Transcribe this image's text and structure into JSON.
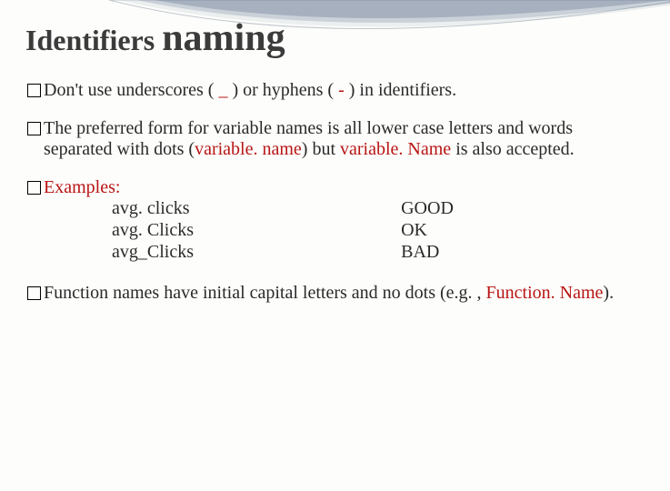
{
  "title": {
    "word1": "Identifiers",
    "word2": "naming"
  },
  "bullets": {
    "b1": {
      "pre": "Don't use underscores ( ",
      "us": "_",
      "mid": " ) or hyphens ( ",
      "hy": "-",
      "post": " ) in identifiers."
    },
    "b2": {
      "t1": "The preferred form for variable names is all lower case letters and words separated with dots (",
      "var1": "variable. name",
      "t2": ") but ",
      "var2": "variable. Name",
      "t3": " is also accepted."
    },
    "b3": {
      "label": "Examples:"
    },
    "b4": {
      "t1": "Function names have initial capital letters and no dots (e.g. , ",
      "fn": "Function. Name",
      "t2": ")."
    }
  },
  "examples": [
    {
      "name": "avg. clicks",
      "rating": "GOOD"
    },
    {
      "name": "avg. Clicks",
      "rating": "OK"
    },
    {
      "name": "avg_Clicks",
      "rating": "BAD"
    }
  ]
}
